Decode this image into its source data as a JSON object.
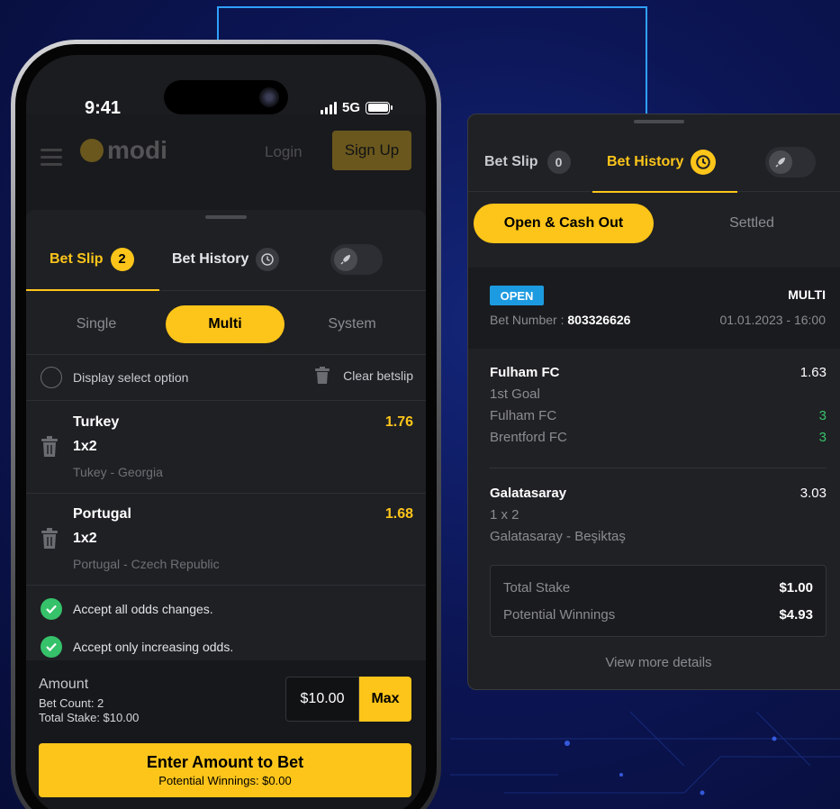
{
  "phone": {
    "status_time": "9:41",
    "network": "5G",
    "bg_app": {
      "logo_text": "modi",
      "login_label": "Login",
      "signup_label": "Sign Up"
    },
    "tabs": {
      "bet_slip_label": "Bet Slip",
      "bet_slip_count": "2",
      "bet_history_label": "Bet History"
    },
    "types": {
      "single": "Single",
      "multi": "Multi",
      "system": "System"
    },
    "display_option": "Display select option",
    "clear_betslip": "Clear betslip",
    "selections": [
      {
        "team": "Turkey",
        "market": "1x2",
        "match": "Tukey - Georgia",
        "odds": "1.76"
      },
      {
        "team": "Portugal",
        "market": "1x2",
        "match": "Portugal - Czech Republic",
        "odds": "1.68"
      }
    ],
    "accept_all": "Accept all odds changes.",
    "accept_increasing": "Accept only increasing odds.",
    "amount": {
      "title": "Amount",
      "bet_count": "Bet Count: 2",
      "total_stake": "Total Stake: $10.00",
      "value": "$10.00",
      "max_label": "Max"
    },
    "bet_button": {
      "label": "Enter Amount to Bet",
      "sub": "Potential Winnings: $0.00"
    }
  },
  "history_panel": {
    "tabs": {
      "bet_slip_label": "Bet Slip",
      "bet_slip_count": "0",
      "bet_history_label": "Bet History"
    },
    "segments": {
      "open": "Open & Cash Out",
      "settled": "Settled"
    },
    "ticket": {
      "status": "OPEN",
      "type": "MULTI",
      "bet_number_label": "Bet Number :",
      "bet_number": "803326626",
      "date": "01.01.2023 - 16:00",
      "legs": [
        {
          "team": "Fulham FC",
          "odds": "1.63",
          "market": "1st Goal",
          "line1": "Fulham FC",
          "score1": "3",
          "line2": "Brentford FC",
          "score2": "3"
        },
        {
          "team": "Galatasaray",
          "odds": "3.03",
          "market": "1 x 2",
          "line1": "Galatasaray - Beşiktaş"
        }
      ],
      "total_stake_label": "Total Stake",
      "total_stake": "$1.00",
      "potential_label": "Potential Winnings",
      "potential": "$4.93",
      "view_more": "View more details"
    }
  },
  "colors": {
    "accent": "#fdc51a",
    "background": "#0c1656",
    "panel": "#202125",
    "success": "#36c26a",
    "badge_open": "#1d9be0"
  },
  "icons": [
    "trash-icon",
    "history-icon",
    "rocket-icon",
    "check-icon",
    "menu-icon"
  ]
}
